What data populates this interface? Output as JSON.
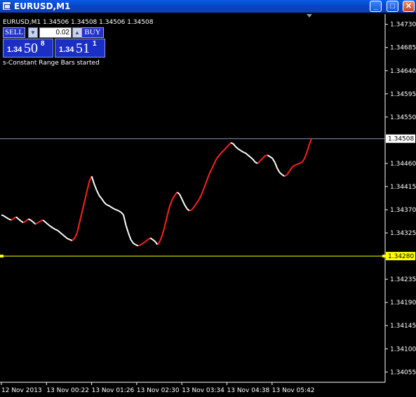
{
  "window": {
    "title": "EURUSD,M1",
    "minimize": "_",
    "maximize": "□",
    "close": "✕"
  },
  "symbol_line": "EURUSD,M1  1.34506 1.34508 1.34506 1.34508",
  "trade_panel": {
    "sell_label": "SELL",
    "buy_label": "BUY",
    "lot": "0.02",
    "sell_prefix": "1.34",
    "sell_big": "50",
    "sell_sup": "8",
    "buy_prefix": "1.34",
    "buy_big": "51",
    "buy_sup": "1"
  },
  "status_message": "s-Constant Range Bars started",
  "colors": {
    "background": "#000000",
    "bull": "#ff2020",
    "bear": "#ffffff",
    "hline": "#ffff00",
    "bidline": "#8899bb",
    "axis": "#ffffff"
  },
  "chart_data": {
    "type": "line",
    "title": "",
    "ylim": [
      1.34035,
      1.3475
    ],
    "price_ticks": [
      "1.34730",
      "1.34685",
      "1.34640",
      "1.34595",
      "1.34550",
      "1.34460",
      "1.34415",
      "1.34370",
      "1.34325",
      "1.34235",
      "1.34190",
      "1.34145",
      "1.34100",
      "1.34055"
    ],
    "current_price": "1.34508",
    "hline_price": "1.34280",
    "time_labels": [
      "12 Nov 2013",
      "13 Nov 00:22",
      "13 Nov 01:26",
      "13 Nov 02:30",
      "13 Nov 03:34",
      "13 Nov 04:38",
      "13 Nov 05:42"
    ],
    "series": [
      {
        "values": [
          1.3436,
          1.34358,
          1.34355,
          1.34352,
          1.3435,
          1.34353,
          1.34356,
          1.34352,
          1.34348,
          1.34345,
          1.34348,
          1.34352,
          1.3435,
          1.34346,
          1.34342,
          1.34345,
          1.34348,
          1.3435,
          1.34346,
          1.34342,
          1.34338,
          1.34335,
          1.34332,
          1.3433,
          1.34326,
          1.34322,
          1.34318,
          1.34314,
          1.34312,
          1.3431,
          1.34315,
          1.34325,
          1.34345,
          1.34365,
          1.34385,
          1.34405,
          1.34425,
          1.34435,
          1.3442,
          1.34408,
          1.34398,
          1.34392,
          1.34385,
          1.3438,
          1.34378,
          1.34375,
          1.34372,
          1.3437,
          1.34368,
          1.34365,
          1.3436,
          1.3434,
          1.34325,
          1.34312,
          1.34305,
          1.34302,
          1.343,
          1.34302,
          1.34305,
          1.34308,
          1.34312,
          1.34315,
          1.34312,
          1.34308,
          1.34302,
          1.3431,
          1.34322,
          1.3434,
          1.3436,
          1.34378,
          1.3439,
          1.34398,
          1.34404,
          1.344,
          1.3439,
          1.3438,
          1.34372,
          1.34368,
          1.3437,
          1.34376,
          1.34383,
          1.3439,
          1.344,
          1.34412,
          1.34425,
          1.34438,
          1.34448,
          1.34458,
          1.34468,
          1.34475,
          1.3448,
          1.34485,
          1.3449,
          1.34495,
          1.345,
          1.34498,
          1.34492,
          1.34488,
          1.34485,
          1.34482,
          1.3448,
          1.34476,
          1.34472,
          1.34468,
          1.34462,
          1.3446,
          1.34465,
          1.3447,
          1.34475,
          1.34476,
          1.34473,
          1.3447,
          1.34462,
          1.3445,
          1.34442,
          1.34438,
          1.34435,
          1.34438,
          1.34445,
          1.34452,
          1.34456,
          1.34458,
          1.3446,
          1.34462,
          1.34468,
          1.3448,
          1.34495,
          1.34508
        ]
      }
    ]
  }
}
